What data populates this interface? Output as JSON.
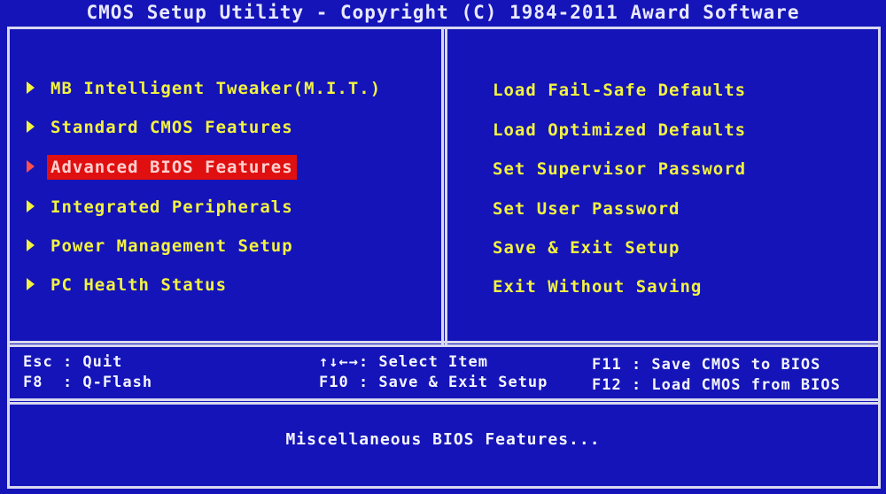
{
  "title": "CMOS Setup Utility - Copyright (C) 1984-2011 Award Software",
  "left_menu": [
    {
      "label": "MB Intelligent Tweaker(M.I.T.)",
      "selected": false
    },
    {
      "label": "Standard CMOS Features",
      "selected": false
    },
    {
      "label": "Advanced BIOS Features",
      "selected": true
    },
    {
      "label": "Integrated Peripherals",
      "selected": false
    },
    {
      "label": "Power Management Setup",
      "selected": false
    },
    {
      "label": "PC Health Status",
      "selected": false
    }
  ],
  "right_menu": [
    {
      "label": "Load Fail-Safe Defaults"
    },
    {
      "label": "Load Optimized Defaults"
    },
    {
      "label": "Set Supervisor Password"
    },
    {
      "label": "Set User Password"
    },
    {
      "label": "Save & Exit Setup"
    },
    {
      "label": "Exit Without Saving"
    }
  ],
  "help": {
    "esc": "Esc : Quit",
    "f8": "F8  : Q-Flash",
    "select": "↑↓←→: Select Item",
    "f10": "F10 : Save & Exit Setup",
    "f11": "F11 : Save CMOS to BIOS",
    "f12": "F12 : Load CMOS from BIOS"
  },
  "status": "Miscellaneous BIOS Features...",
  "colors": {
    "background": "#1414b8",
    "menu_text": "#f2f240",
    "highlight": "#e01010",
    "border": "#d8d8f0"
  }
}
